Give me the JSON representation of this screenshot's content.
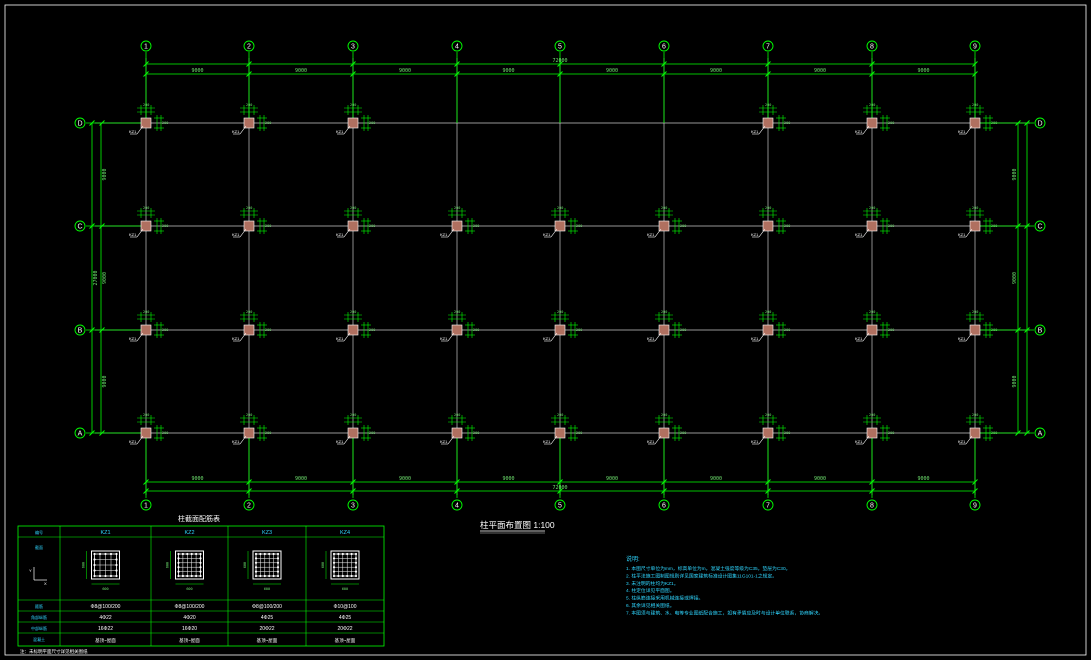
{
  "drawing": {
    "title": "柱平面布置图 1:100",
    "axes_x": [
      "1",
      "2",
      "3",
      "4",
      "5",
      "6",
      "7",
      "8",
      "9"
    ],
    "axes_y": [
      "D",
      "C",
      "B",
      "A"
    ],
    "dim_top_spans": [
      "9000",
      "9000",
      "9000",
      "9000",
      "9000",
      "9000",
      "9000",
      "9000"
    ],
    "dim_top_total": "72000",
    "dim_bottom_spans": [
      "9000",
      "9000",
      "9000",
      "9000",
      "9000",
      "9000",
      "9000",
      "9000"
    ],
    "dim_bottom_total": "72000",
    "dim_left_spans": [
      "9000",
      "9000",
      "9000"
    ],
    "dim_left_total": "27000",
    "dim_right_spans": [
      "9000",
      "9000",
      "9000"
    ],
    "column_label": "KZ1",
    "colors": {
      "grid": "#c8c8c8",
      "dim": "#00ff00",
      "column": "#b07060",
      "text_cyan": "#2fd6ff"
    }
  },
  "schedule": {
    "title": "柱截面配筋表",
    "row_labels": [
      "编号",
      "截面",
      "箍筋",
      "角部纵筋",
      "中部纵筋",
      "混凝土"
    ],
    "columns": [
      {
        "name": "KZ1",
        "hoop": "Φ8@100/200",
        "corner": "4Φ22",
        "middle": "16Φ22",
        "concrete": "基顶~屋面"
      },
      {
        "name": "KZ2",
        "hoop": "Φ8@100/200",
        "corner": "4Φ20",
        "middle": "16Φ20",
        "concrete": "基顶~屋面"
      },
      {
        "name": "KZ3",
        "hoop": "Φ8@100/200",
        "corner": "4Φ25",
        "middle": "20Φ22",
        "concrete": "基顶~屋面"
      },
      {
        "name": "KZ4",
        "hoop": "Φ10@100",
        "corner": "4Φ25",
        "middle": "20Φ22",
        "concrete": "基顶~屋面"
      }
    ],
    "footnote": "注：未标明平面尺寸详见相关图纸"
  },
  "notes": {
    "heading": "说明:",
    "lines": [
      "1. 本图尺寸单位为mm，标高单位为m，混凝土强度等级为C35，垫层为C30。",
      "2. 柱平法施工图制图规则详见国家建筑标准设计图集11G101-1之规定。",
      "3. 未注明的柱均为KZ1。",
      "4. 柱定位详见平面图。",
      "5. 柱纵筋连接采用机械连接或焊接。",
      "6. 其余详见相关图纸。",
      "7. 本图须与建筑、水、电等专业图纸配合施工，如有矛盾应及时与设计单位联系，协商解决。"
    ]
  }
}
